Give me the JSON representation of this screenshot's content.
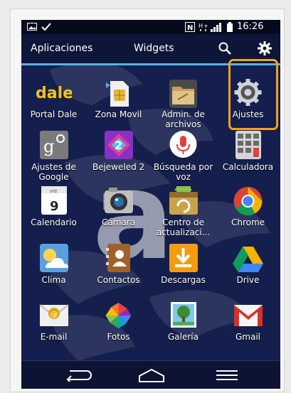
{
  "status_bar": {
    "time": "16:26"
  },
  "tabs": [
    {
      "label": "Aplicaciones",
      "active": true
    },
    {
      "label": "Widgets",
      "active": false
    }
  ],
  "toolbar": {
    "search_icon": "search-icon",
    "settings_icon": "gear-icon"
  },
  "apps": [
    {
      "label": "Portal Dale",
      "icon": "dale-logo"
    },
    {
      "label": "Zona Movil",
      "icon": "sim-card-icon"
    },
    {
      "label": "Admin. de archivos",
      "icon": "folder-icon"
    },
    {
      "label": "Ajustes",
      "icon": "gear-icon"
    },
    {
      "label": "Ajustes de Google",
      "icon": "google-settings-icon"
    },
    {
      "label": "Bejeweled 2",
      "icon": "bejeweled-icon"
    },
    {
      "label": "Búsqueda por voz",
      "icon": "microphone-icon"
    },
    {
      "label": "Calculadora",
      "icon": "calculator-icon"
    },
    {
      "label": "Calendario",
      "icon": "calendar-icon",
      "date_month": "vie",
      "date_day": "9"
    },
    {
      "label": "Cámara",
      "icon": "camera-icon"
    },
    {
      "label": "Centro de actualizaci...",
      "icon": "update-center-icon"
    },
    {
      "label": "Chrome",
      "icon": "chrome-icon"
    },
    {
      "label": "Clima",
      "icon": "weather-icon"
    },
    {
      "label": "Contactos",
      "icon": "contacts-icon"
    },
    {
      "label": "Descargas",
      "icon": "download-icon"
    },
    {
      "label": "Drive",
      "icon": "drive-icon"
    },
    {
      "label": "E-mail",
      "icon": "email-icon"
    },
    {
      "label": "Fotos",
      "icon": "photos-icon"
    },
    {
      "label": "Galería",
      "icon": "gallery-icon"
    },
    {
      "label": "Gmail",
      "icon": "gmail-icon"
    }
  ],
  "nav_bar": {
    "back_icon": "back-icon",
    "home_icon": "home-icon",
    "menu_icon": "menu-icon"
  },
  "colors": {
    "highlight": "#f5a21b",
    "tab_indicator": "#5ab2e8",
    "background": "#141f4d"
  }
}
